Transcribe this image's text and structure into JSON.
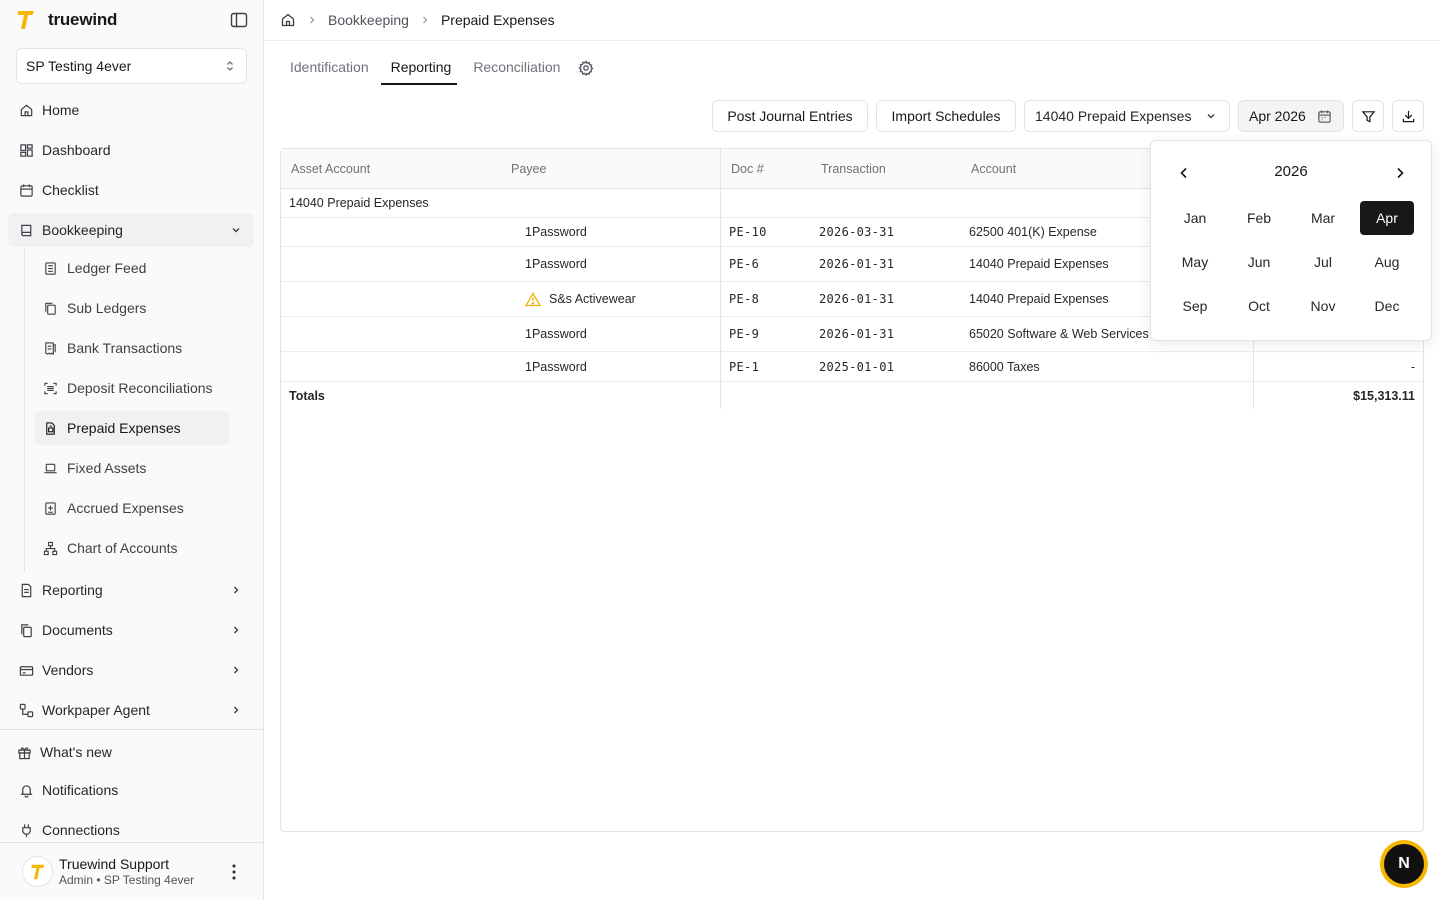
{
  "app": {
    "name": "truewind",
    "brand_color": "#f5b700"
  },
  "org": {
    "name": "SP Testing 4ever"
  },
  "sidebar": {
    "items": [
      {
        "label": "Home",
        "icon": "home-icon"
      },
      {
        "label": "Dashboard",
        "icon": "dashboard-icon"
      },
      {
        "label": "Checklist",
        "icon": "calendar-check-icon"
      },
      {
        "label": "Bookkeeping",
        "icon": "book-icon"
      }
    ],
    "bookkeeping_sub": [
      {
        "label": "Ledger Feed",
        "icon": "ledger-icon"
      },
      {
        "label": "Sub Ledgers",
        "icon": "copy-icon"
      },
      {
        "label": "Bank Transactions",
        "icon": "receipt-icon"
      },
      {
        "label": "Deposit Reconciliations",
        "icon": "scan-icon"
      },
      {
        "label": "Prepaid Expenses",
        "icon": "prepaid-icon"
      },
      {
        "label": "Fixed Assets",
        "icon": "laptop-icon"
      },
      {
        "label": "Accrued Expenses",
        "icon": "accrued-icon"
      },
      {
        "label": "Chart of Accounts",
        "icon": "hierarchy-icon"
      }
    ],
    "lower_items": [
      {
        "label": "Reporting",
        "icon": "report-icon"
      },
      {
        "label": "Documents",
        "icon": "documents-icon"
      },
      {
        "label": "Vendors",
        "icon": "vendors-icon"
      },
      {
        "label": "Workpaper Agent",
        "icon": "workflow-icon"
      }
    ],
    "footer_items": [
      {
        "label": "What's new",
        "icon": "gift-icon"
      },
      {
        "label": "Notifications",
        "icon": "bell-icon"
      },
      {
        "label": "Connections",
        "icon": "plug-icon"
      }
    ]
  },
  "user": {
    "name": "Truewind Support",
    "role": "Admin • SP Testing 4ever"
  },
  "breadcrumb": {
    "section": "Bookkeeping",
    "current": "Prepaid Expenses"
  },
  "tabs": [
    "Identification",
    "Reporting",
    "Reconciliation"
  ],
  "toolbar": {
    "post_label": "Post Journal Entries",
    "import_label": "Import Schedules",
    "account_select": "14040 Prepaid Expenses",
    "date_value": "Apr 2026"
  },
  "table": {
    "headers": [
      "Asset Account",
      "Payee",
      "Doc #",
      "Transaction",
      "Account"
    ],
    "group_label": "14040 Prepaid Expenses",
    "rows": [
      {
        "payee": "1Password",
        "doc": "PE-10",
        "date": "2026-03-31",
        "account": "62500 401(K) Expense",
        "amount": "",
        "warning": false
      },
      {
        "payee": "1Password",
        "doc": "PE-6",
        "date": "2026-01-31",
        "account": "14040 Prepaid Expenses",
        "amount": "",
        "warning": false
      },
      {
        "payee": "S&s Activewear",
        "doc": "PE-8",
        "date": "2026-01-31",
        "account": "14040 Prepaid Expenses",
        "amount": "",
        "warning": true
      },
      {
        "payee": "1Password",
        "doc": "PE-9",
        "date": "2026-01-31",
        "account": "65020 Software & Web Services",
        "amount": "",
        "warning": false
      },
      {
        "payee": "1Password",
        "doc": "PE-1",
        "date": "2025-01-01",
        "account": "86000 Taxes",
        "amount": "-",
        "warning": false
      }
    ],
    "totals_label": "Totals",
    "totals_value": "$15,313.11"
  },
  "month_picker": {
    "year": "2026",
    "months": [
      "Jan",
      "Feb",
      "Mar",
      "Apr",
      "May",
      "Jun",
      "Jul",
      "Aug",
      "Sep",
      "Oct",
      "Nov",
      "Dec"
    ],
    "selected": "Apr"
  },
  "fab": {
    "label": "N"
  }
}
